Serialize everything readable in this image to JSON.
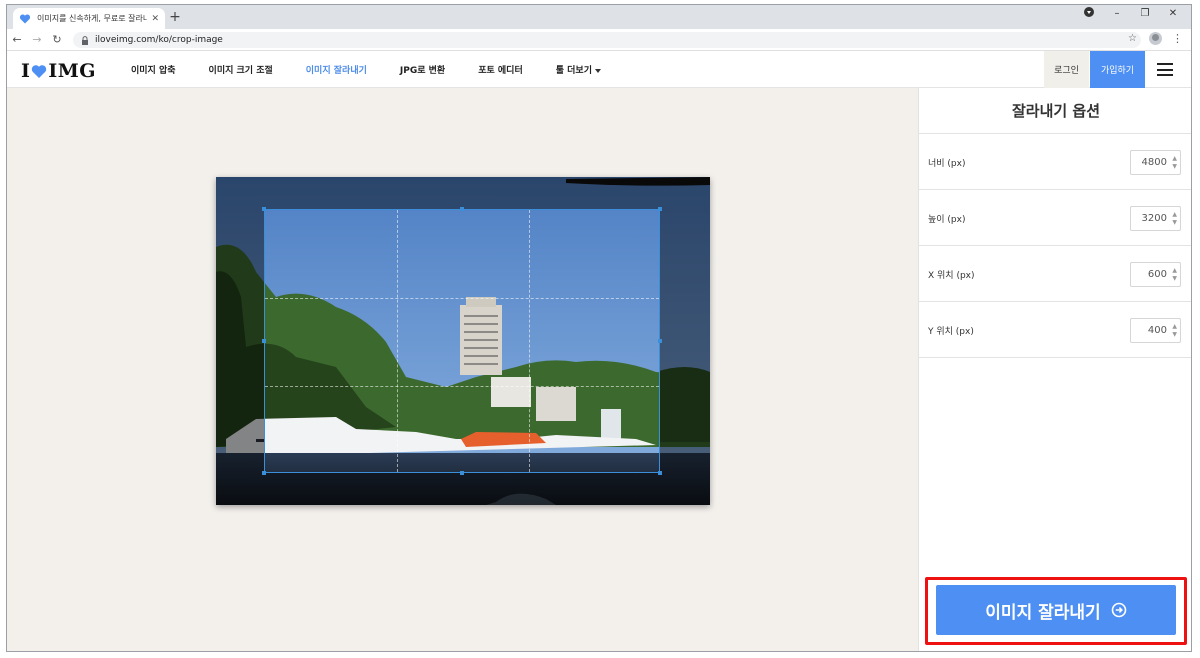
{
  "browser": {
    "tab_title": "이미지를 신속하게, 무료로 잘라내기",
    "tab_close": "✕",
    "new_tab": "+",
    "url": "iloveimg.com/ko/crop-image",
    "window_controls": {
      "minimize": "–",
      "restore": "❐",
      "close": "✕"
    }
  },
  "site": {
    "logo_left": "I",
    "logo_right": "IMG",
    "nav": [
      {
        "label": "이미지 압축"
      },
      {
        "label": "이미지 크기 조절"
      },
      {
        "label": "이미지 잘라내기"
      },
      {
        "label": "JPG로 변환"
      },
      {
        "label": "포토 에디터"
      },
      {
        "label": "툴 더보기"
      }
    ],
    "login_label": "로그인",
    "signup_label": "가입하기",
    "accent_color": "#4d8ff2"
  },
  "sidebar": {
    "title": "잘라내기 옵션",
    "options": [
      {
        "label": "너비 (px)",
        "value": "4800"
      },
      {
        "label": "높이 (px)",
        "value": "3200"
      },
      {
        "label": "X 위치 (px)",
        "value": "600"
      },
      {
        "label": "Y 위치 (px)",
        "value": "400"
      }
    ],
    "crop_button_label": "이미지 잘라내기"
  }
}
